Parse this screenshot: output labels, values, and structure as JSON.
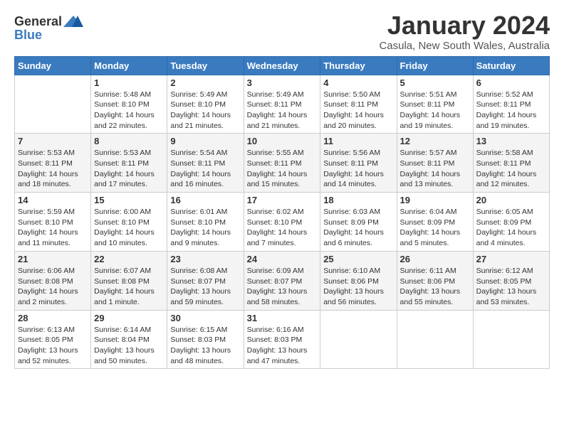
{
  "logo": {
    "general": "General",
    "blue": "Blue"
  },
  "title": "January 2024",
  "subtitle": "Casula, New South Wales, Australia",
  "weekdays": [
    "Sunday",
    "Monday",
    "Tuesday",
    "Wednesday",
    "Thursday",
    "Friday",
    "Saturday"
  ],
  "weeks": [
    [
      {
        "day": "",
        "info": ""
      },
      {
        "day": "1",
        "info": "Sunrise: 5:48 AM\nSunset: 8:10 PM\nDaylight: 14 hours\nand 22 minutes."
      },
      {
        "day": "2",
        "info": "Sunrise: 5:49 AM\nSunset: 8:10 PM\nDaylight: 14 hours\nand 21 minutes."
      },
      {
        "day": "3",
        "info": "Sunrise: 5:49 AM\nSunset: 8:11 PM\nDaylight: 14 hours\nand 21 minutes."
      },
      {
        "day": "4",
        "info": "Sunrise: 5:50 AM\nSunset: 8:11 PM\nDaylight: 14 hours\nand 20 minutes."
      },
      {
        "day": "5",
        "info": "Sunrise: 5:51 AM\nSunset: 8:11 PM\nDaylight: 14 hours\nand 19 minutes."
      },
      {
        "day": "6",
        "info": "Sunrise: 5:52 AM\nSunset: 8:11 PM\nDaylight: 14 hours\nand 19 minutes."
      }
    ],
    [
      {
        "day": "7",
        "info": "Sunrise: 5:53 AM\nSunset: 8:11 PM\nDaylight: 14 hours\nand 18 minutes."
      },
      {
        "day": "8",
        "info": "Sunrise: 5:53 AM\nSunset: 8:11 PM\nDaylight: 14 hours\nand 17 minutes."
      },
      {
        "day": "9",
        "info": "Sunrise: 5:54 AM\nSunset: 8:11 PM\nDaylight: 14 hours\nand 16 minutes."
      },
      {
        "day": "10",
        "info": "Sunrise: 5:55 AM\nSunset: 8:11 PM\nDaylight: 14 hours\nand 15 minutes."
      },
      {
        "day": "11",
        "info": "Sunrise: 5:56 AM\nSunset: 8:11 PM\nDaylight: 14 hours\nand 14 minutes."
      },
      {
        "day": "12",
        "info": "Sunrise: 5:57 AM\nSunset: 8:11 PM\nDaylight: 14 hours\nand 13 minutes."
      },
      {
        "day": "13",
        "info": "Sunrise: 5:58 AM\nSunset: 8:11 PM\nDaylight: 14 hours\nand 12 minutes."
      }
    ],
    [
      {
        "day": "14",
        "info": "Sunrise: 5:59 AM\nSunset: 8:10 PM\nDaylight: 14 hours\nand 11 minutes."
      },
      {
        "day": "15",
        "info": "Sunrise: 6:00 AM\nSunset: 8:10 PM\nDaylight: 14 hours\nand 10 minutes."
      },
      {
        "day": "16",
        "info": "Sunrise: 6:01 AM\nSunset: 8:10 PM\nDaylight: 14 hours\nand 9 minutes."
      },
      {
        "day": "17",
        "info": "Sunrise: 6:02 AM\nSunset: 8:10 PM\nDaylight: 14 hours\nand 7 minutes."
      },
      {
        "day": "18",
        "info": "Sunrise: 6:03 AM\nSunset: 8:09 PM\nDaylight: 14 hours\nand 6 minutes."
      },
      {
        "day": "19",
        "info": "Sunrise: 6:04 AM\nSunset: 8:09 PM\nDaylight: 14 hours\nand 5 minutes."
      },
      {
        "day": "20",
        "info": "Sunrise: 6:05 AM\nSunset: 8:09 PM\nDaylight: 14 hours\nand 4 minutes."
      }
    ],
    [
      {
        "day": "21",
        "info": "Sunrise: 6:06 AM\nSunset: 8:08 PM\nDaylight: 14 hours\nand 2 minutes."
      },
      {
        "day": "22",
        "info": "Sunrise: 6:07 AM\nSunset: 8:08 PM\nDaylight: 14 hours\nand 1 minute."
      },
      {
        "day": "23",
        "info": "Sunrise: 6:08 AM\nSunset: 8:07 PM\nDaylight: 13 hours\nand 59 minutes."
      },
      {
        "day": "24",
        "info": "Sunrise: 6:09 AM\nSunset: 8:07 PM\nDaylight: 13 hours\nand 58 minutes."
      },
      {
        "day": "25",
        "info": "Sunrise: 6:10 AM\nSunset: 8:06 PM\nDaylight: 13 hours\nand 56 minutes."
      },
      {
        "day": "26",
        "info": "Sunrise: 6:11 AM\nSunset: 8:06 PM\nDaylight: 13 hours\nand 55 minutes."
      },
      {
        "day": "27",
        "info": "Sunrise: 6:12 AM\nSunset: 8:05 PM\nDaylight: 13 hours\nand 53 minutes."
      }
    ],
    [
      {
        "day": "28",
        "info": "Sunrise: 6:13 AM\nSunset: 8:05 PM\nDaylight: 13 hours\nand 52 minutes."
      },
      {
        "day": "29",
        "info": "Sunrise: 6:14 AM\nSunset: 8:04 PM\nDaylight: 13 hours\nand 50 minutes."
      },
      {
        "day": "30",
        "info": "Sunrise: 6:15 AM\nSunset: 8:03 PM\nDaylight: 13 hours\nand 48 minutes."
      },
      {
        "day": "31",
        "info": "Sunrise: 6:16 AM\nSunset: 8:03 PM\nDaylight: 13 hours\nand 47 minutes."
      },
      {
        "day": "",
        "info": ""
      },
      {
        "day": "",
        "info": ""
      },
      {
        "day": "",
        "info": ""
      }
    ]
  ]
}
